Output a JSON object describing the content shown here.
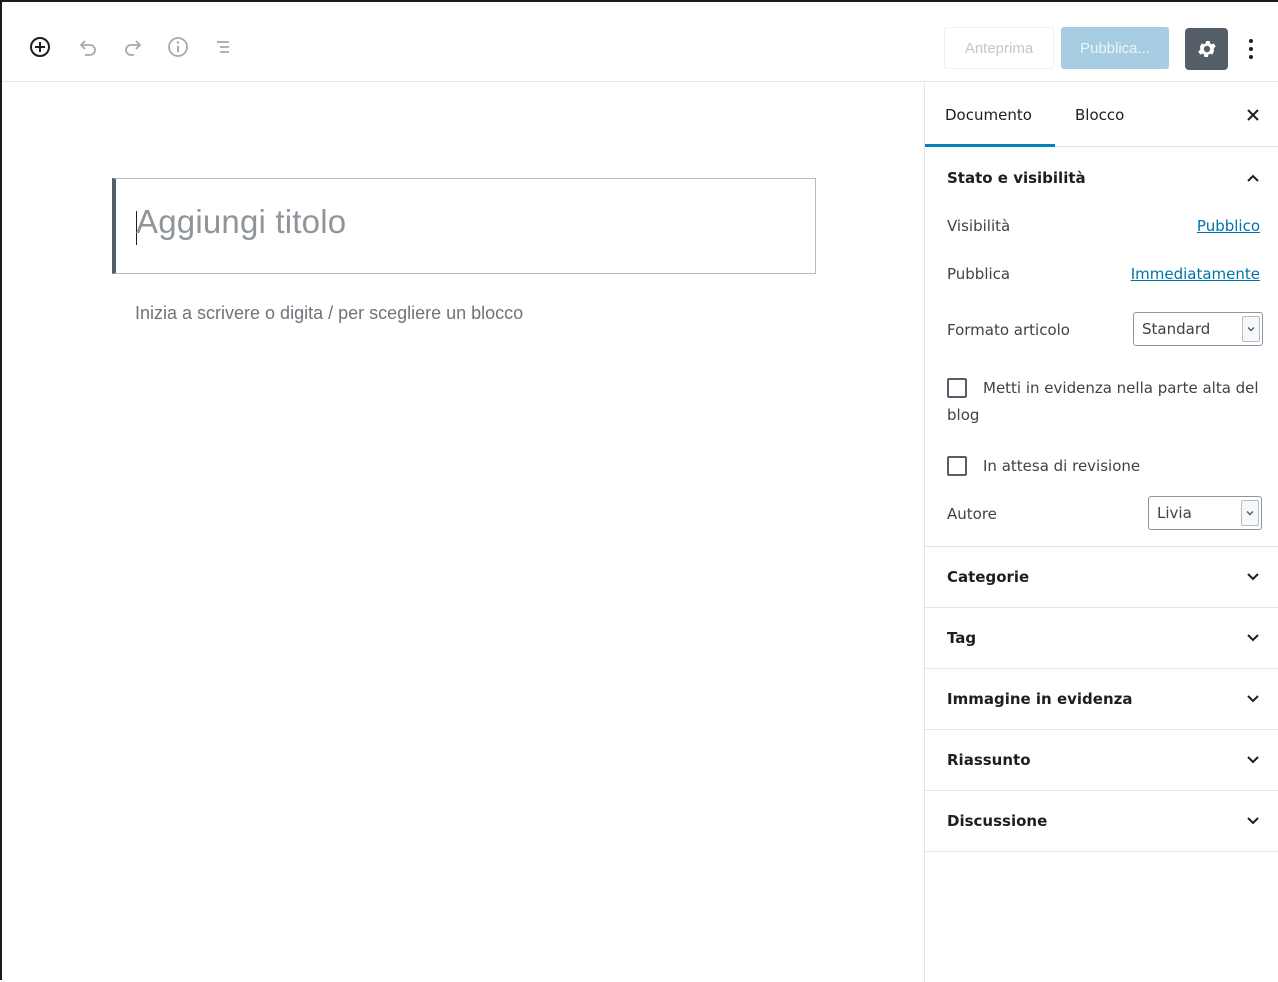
{
  "toolbar": {
    "add_block_icon": "plus-circle-icon",
    "undo_icon": "undo-icon",
    "redo_icon": "redo-icon",
    "info_icon": "info-icon",
    "outline_icon": "list-outline-icon",
    "preview_label": "Anteprima",
    "publish_label": "Pubblica...",
    "settings_icon": "gear-icon",
    "more_icon": "more-vertical-icon"
  },
  "editor": {
    "title_placeholder": "Aggiungi titolo",
    "body_placeholder": "Inizia a scrivere o digita / per scegliere un blocco"
  },
  "sidebar": {
    "tabs": [
      {
        "label": "Documento",
        "active": true
      },
      {
        "label": "Blocco",
        "active": false
      }
    ],
    "status_panel": {
      "title": "Stato e visibilità",
      "visibility_label": "Visibilità",
      "visibility_value": "Pubblico",
      "publish_label": "Pubblica",
      "publish_value": "Immediatamente",
      "format_label": "Formato articolo",
      "format_value": "Standard",
      "sticky_label_line1": "Metti in evidenza nella parte alta del",
      "sticky_label_line2": "blog",
      "pending_label": "In attesa di revisione",
      "author_label": "Autore",
      "author_value": "Livia"
    },
    "panels": [
      {
        "title": "Categorie"
      },
      {
        "title": "Tag"
      },
      {
        "title": "Immagine in evidenza"
      },
      {
        "title": "Riassunto"
      },
      {
        "title": "Discussione"
      }
    ]
  },
  "colors": {
    "accent": "#0085ba",
    "link": "#0073aa",
    "publish_bg": "#a7cde3",
    "settings_bg": "#555d66"
  }
}
